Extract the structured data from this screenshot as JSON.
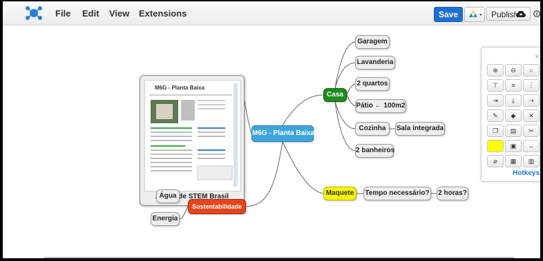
{
  "menu": {
    "file": "File",
    "edit": "Edit",
    "view": "View",
    "extensions": "Extensions"
  },
  "toolbar": {
    "save": "Save",
    "publish": "Publish",
    "drive_icon": "google-drive-icon",
    "cloud_icon": "cloud-upload-icon",
    "info_icon": "info-icon"
  },
  "map": {
    "center": "M6G - Planta Baixa",
    "casa": "Casa",
    "casa_children": [
      "Garagem",
      "Lavanderia",
      "2 quartos",
      "Pátio ← 100m2",
      "Cozinha",
      "2 banheiros"
    ],
    "cozinha_child": "Sala integrada",
    "maquete": "Maquete",
    "tempo": "Tempo necessário?",
    "horas": "2 horas?",
    "sustentabilidade": "Sustentabilidade",
    "agua": "Água",
    "energia": "Energia",
    "image_caption": "Atividade STEM Brasil",
    "doc_title": "M6G - Planta Baixa"
  },
  "tool_panel": {
    "close": "×",
    "hotkeys": "Hotkeys",
    "icons": [
      "zoom-in-icon",
      "zoom-out-icon",
      "circle-icon",
      "hierarchy-icon",
      "list-icon",
      "vertical-dots-icon",
      "insert-child-icon",
      "download-icon",
      "insert-sibling-icon",
      "pencil-icon",
      "eraser-icon",
      "delete-icon",
      "copy-icon",
      "paste-icon",
      "cut-icon",
      "color-swatch-icon",
      "image-icon",
      "link-arrow-icon",
      "attachment-icon",
      "table-icon",
      "film-icon"
    ]
  },
  "colors": {
    "save": "#1d6fd1",
    "center": "#3ea5dd",
    "casa": "#1f8a1f",
    "maquete": "#f6f30a",
    "sustentabilidade": "#e5451d",
    "swatch": "#ffff00",
    "hotkeys": "#1a7bd6"
  }
}
